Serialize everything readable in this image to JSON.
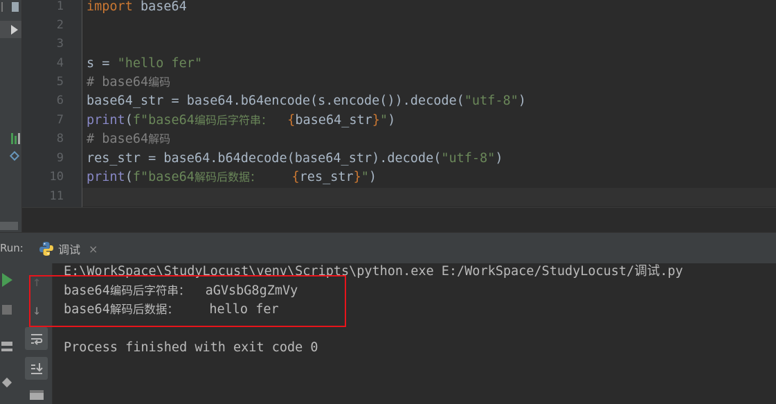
{
  "editor": {
    "line_numbers": [
      "1",
      "2",
      "3",
      "4",
      "5",
      "6",
      "7",
      "8",
      "9",
      "10",
      "11"
    ],
    "lines": {
      "l1_kw": "import",
      "l1_rest": " base64",
      "l4_a": "s = ",
      "l4_str": "\"hello fer\"",
      "l5_hash": "# base64",
      "l5_cjk": "编码",
      "l6_a": "base64_str = base64.b64encode(s.encode()).decode(",
      "l6_str": "\"utf-8\"",
      "l6_b": ")",
      "l7_print": "print",
      "l7_a": "(",
      "l7_str1": "f\"base64",
      "l7_cjk": "编码后字符串：",
      "l7_sp": "  ",
      "l7_brace1": "{",
      "l7_var": "base64_str",
      "l7_brace2": "}",
      "l7_str2": "\"",
      "l7_b": ")",
      "l8_hash": "# base64",
      "l8_cjk": "解码",
      "l9_a": "res_str = base64.b64decode(base64_str).decode(",
      "l9_str": "\"utf-8\"",
      "l9_b": ")",
      "l10_print": "print",
      "l10_a": "(",
      "l10_str1": "f\"base64",
      "l10_cjk": "解码后数据：",
      "l10_sp": "    ",
      "l10_brace1": "{",
      "l10_var": "res_str",
      "l10_brace2": "}",
      "l10_str2": "\"",
      "l10_b": ")"
    }
  },
  "run_panel": {
    "label": "Run:",
    "tab_label": "调试",
    "tab_close": "×"
  },
  "console": {
    "command": "E:\\WorkSpace\\StudyLocust\\venv\\Scripts\\python.exe E:/WorkSpace/StudyLocust/调试.py",
    "out1_prefix": "base64",
    "out1_cjk": "编码后字符串：",
    "out1_value": "  aGVsbG8gZmVy",
    "out2_prefix": "base64",
    "out2_cjk": "解码后数据：",
    "out2_value": "    hello fer",
    "finish": "Process finished with exit code 0"
  },
  "colors": {
    "keyword": "#cc7832",
    "string": "#6a8759",
    "comment": "#808080",
    "builtin": "#8888c6",
    "highlight": "#e8141b"
  }
}
